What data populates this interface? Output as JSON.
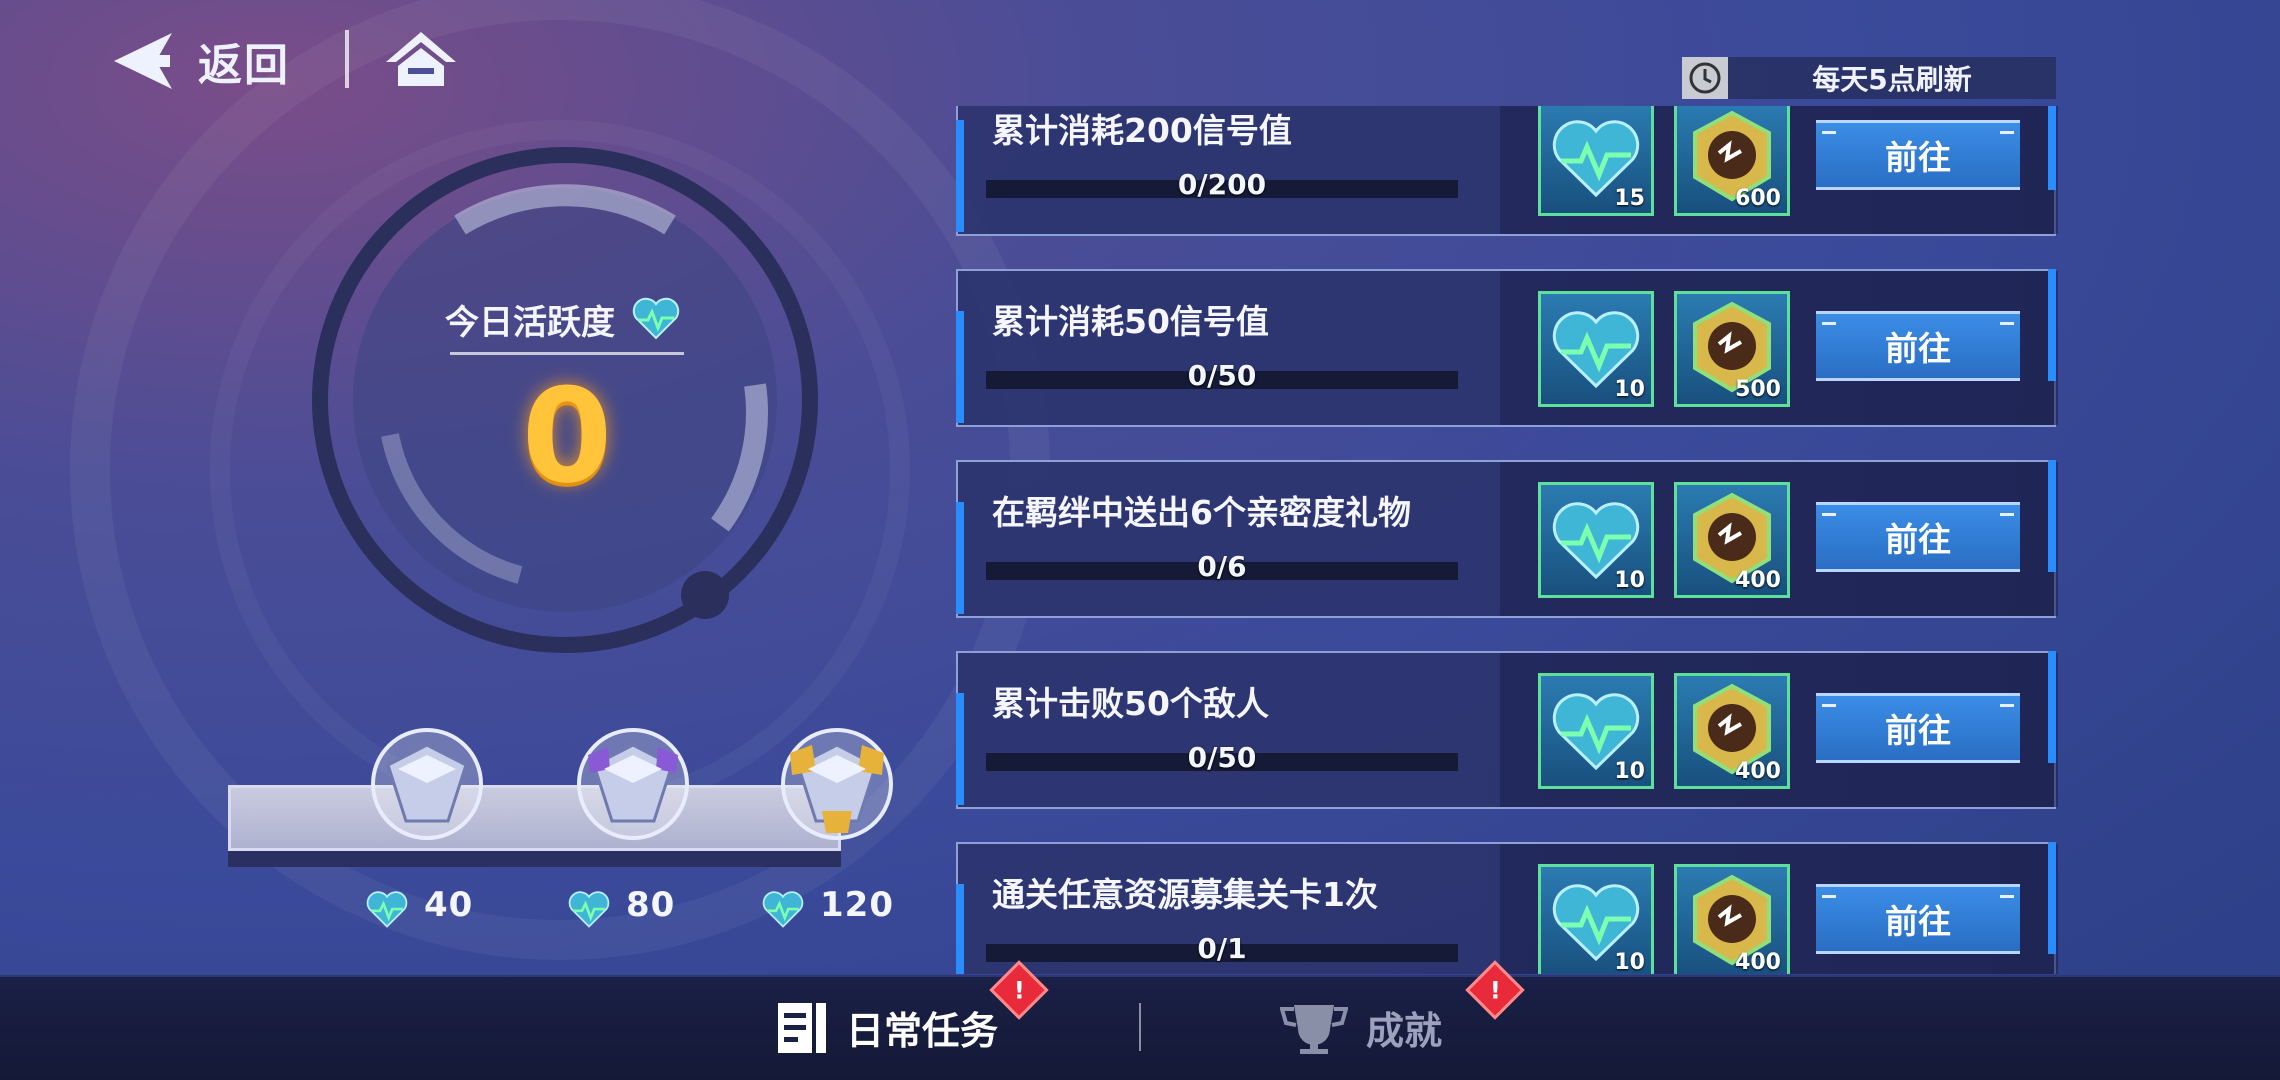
{
  "nav": {
    "back_label": "返回",
    "refresh_text": "每天5点刷新"
  },
  "activity": {
    "label": "今日活跃度",
    "value": "0"
  },
  "chests": [
    {
      "threshold": "40",
      "tier": "silver"
    },
    {
      "threshold": "80",
      "tier": "purple"
    },
    {
      "threshold": "120",
      "tier": "gold"
    }
  ],
  "tasks": [
    {
      "title": "累计消耗200信号值",
      "progress": "0/200",
      "reward_activity": "15",
      "reward_coin": "600",
      "button": "前往"
    },
    {
      "title": "累计消耗50信号值",
      "progress": "0/50",
      "reward_activity": "10",
      "reward_coin": "500",
      "button": "前往"
    },
    {
      "title": "在羁绊中送出6个亲密度礼物",
      "progress": "0/6",
      "reward_activity": "10",
      "reward_coin": "400",
      "button": "前往"
    },
    {
      "title": "累计击败50个敌人",
      "progress": "0/50",
      "reward_activity": "10",
      "reward_coin": "400",
      "button": "前往"
    },
    {
      "title": "通关任意资源募集关卡1次",
      "progress": "0/1",
      "reward_activity": "10",
      "reward_coin": "400",
      "button": "前往"
    }
  ],
  "tabs": {
    "daily": "日常任务",
    "achievement": "成就"
  },
  "colors": {
    "accent_blue": "#2a8dff",
    "activity_orange": "#ffc43a",
    "alert_red": "#e82a3a"
  }
}
